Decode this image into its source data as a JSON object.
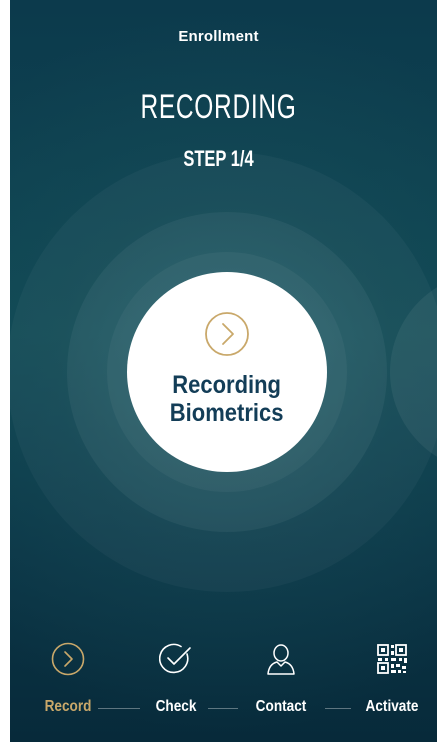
{
  "header": {
    "title": "Enrollment"
  },
  "main": {
    "title": "RECORDING",
    "step": "STEP 1/4",
    "action": {
      "label": "Recording\nBiometrics",
      "icon": "chevron-right-circle-icon"
    }
  },
  "bottom_nav": {
    "items": [
      {
        "label": "Record",
        "icon": "chevron-right-circle-icon",
        "active": true
      },
      {
        "label": "Check",
        "icon": "checkmark-circle-icon",
        "active": false
      },
      {
        "label": "Contact",
        "icon": "user-icon",
        "active": false
      },
      {
        "label": "Activate",
        "icon": "qr-code-icon",
        "active": false
      }
    ]
  },
  "colors": {
    "accent_gold": "#c9a86a",
    "background_dark": "#0c3a4c",
    "circle_text": "#133d57"
  }
}
